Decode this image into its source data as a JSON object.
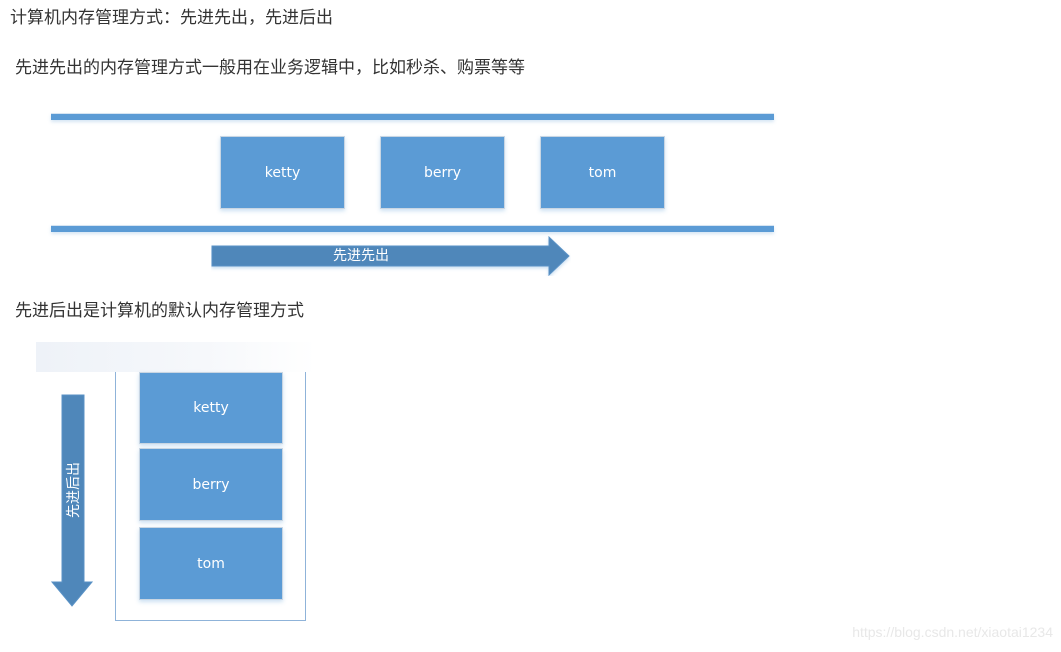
{
  "heading": "计算机内存管理方式：先进先出，先进后出",
  "fifo": {
    "description": "先进先出的内存管理方式一般用在业务逻辑中，比如秒杀、购票等等",
    "items": [
      "ketty",
      "berry",
      "tom"
    ],
    "arrow_label": "先进先出",
    "arrow_direction": "right"
  },
  "lifo": {
    "description": "先进后出是计算机的默认内存管理方式",
    "items": [
      "ketty",
      "berry",
      "tom"
    ],
    "arrow_label": "先进后出",
    "arrow_direction": "down"
  },
  "colors": {
    "box_fill": "#5b9bd5",
    "arrow_fill": "#4f87ba",
    "text": "#333333"
  },
  "watermark": "https://blog.csdn.net/xiaotai1234"
}
